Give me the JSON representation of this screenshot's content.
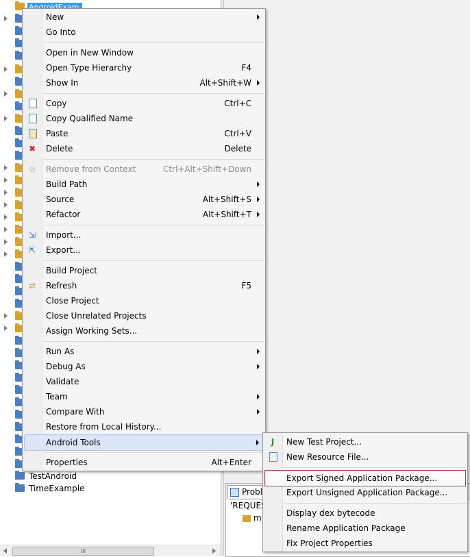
{
  "explorer": {
    "first_item": "AndroidExam",
    "items": [
      "TestAndroid",
      "TimeExample"
    ]
  },
  "problems_panel": {
    "tab_label": "Proble",
    "line1": "'REQUEST",
    "line2": "m"
  },
  "context_menu": {
    "new": "New",
    "go_into": "Go Into",
    "open_new_window": "Open in New Window",
    "open_type_hierarchy": "Open Type Hierarchy",
    "open_type_hierarchy_sc": "F4",
    "show_in": "Show In",
    "show_in_sc": "Alt+Shift+W",
    "copy": "Copy",
    "copy_sc": "Ctrl+C",
    "copy_qualified": "Copy Qualified Name",
    "paste": "Paste",
    "paste_sc": "Ctrl+V",
    "delete": "Delete",
    "delete_sc": "Delete",
    "remove_context": "Remove from Context",
    "remove_context_sc": "Ctrl+Alt+Shift+Down",
    "build_path": "Build Path",
    "source": "Source",
    "source_sc": "Alt+Shift+S",
    "refactor": "Refactor",
    "refactor_sc": "Alt+Shift+T",
    "import": "Import...",
    "export": "Export...",
    "build_project": "Build Project",
    "refresh": "Refresh",
    "refresh_sc": "F5",
    "close_project": "Close Project",
    "close_unrelated": "Close Unrelated Projects",
    "assign_working_sets": "Assign Working Sets...",
    "run_as": "Run As",
    "debug_as": "Debug As",
    "validate": "Validate",
    "team": "Team",
    "compare_with": "Compare With",
    "restore_history": "Restore from Local History...",
    "android_tools": "Android Tools",
    "properties": "Properties",
    "properties_sc": "Alt+Enter"
  },
  "android_submenu": {
    "new_test_project": "New Test Project...",
    "new_resource_file": "New Resource File...",
    "export_signed": "Export Signed Application Package...",
    "export_unsigned": "Export Unsigned Application Package...",
    "display_dex": "Display dex bytecode",
    "rename_package": "Rename Application Package",
    "fix_properties": "Fix Project Properties"
  },
  "scrollbar": {
    "grip": "III"
  }
}
